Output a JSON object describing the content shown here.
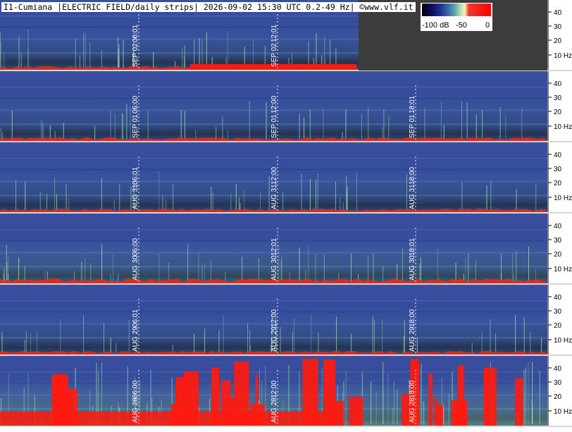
{
  "title": "I1-Cumiana |ELECTRIC FIELD/daily strips| 2026-09-02 15:30 UTC 0.2-49 Hz| ©www.vlf.it",
  "colorbar": {
    "labels": [
      "-100 dB",
      "-50",
      "0"
    ],
    "colors": [
      "#000000",
      "#1b2a8a",
      "#5fa8b0",
      "#f4f2c0",
      "#ff0000"
    ]
  },
  "y_axis": {
    "ticks": [
      "40",
      "30",
      "20",
      "10 Hz"
    ]
  },
  "strips": [
    {
      "date": "SEP 02",
      "markers": [
        "06:01",
        "12:01"
      ],
      "complete": false,
      "activity": "low-evening"
    },
    {
      "date": "SEP 01",
      "markers": [
        "06:00",
        "12:00",
        "18:01"
      ],
      "complete": true,
      "activity": "low"
    },
    {
      "date": "AUG 31",
      "markers": [
        "06:01",
        "12:00",
        "18:00"
      ],
      "complete": true,
      "activity": "low"
    },
    {
      "date": "AUG 30",
      "markers": [
        "06:00",
        "12:01",
        "18:01"
      ],
      "complete": true,
      "activity": "medium"
    },
    {
      "date": "AUG 29",
      "markers": [
        "06:01",
        "12:00",
        "18:00"
      ],
      "complete": true,
      "activity": "low"
    },
    {
      "date": "AUG 28",
      "markers": [
        "06:00",
        "12:00",
        "18:00"
      ],
      "complete": true,
      "activity": "high"
    }
  ]
}
